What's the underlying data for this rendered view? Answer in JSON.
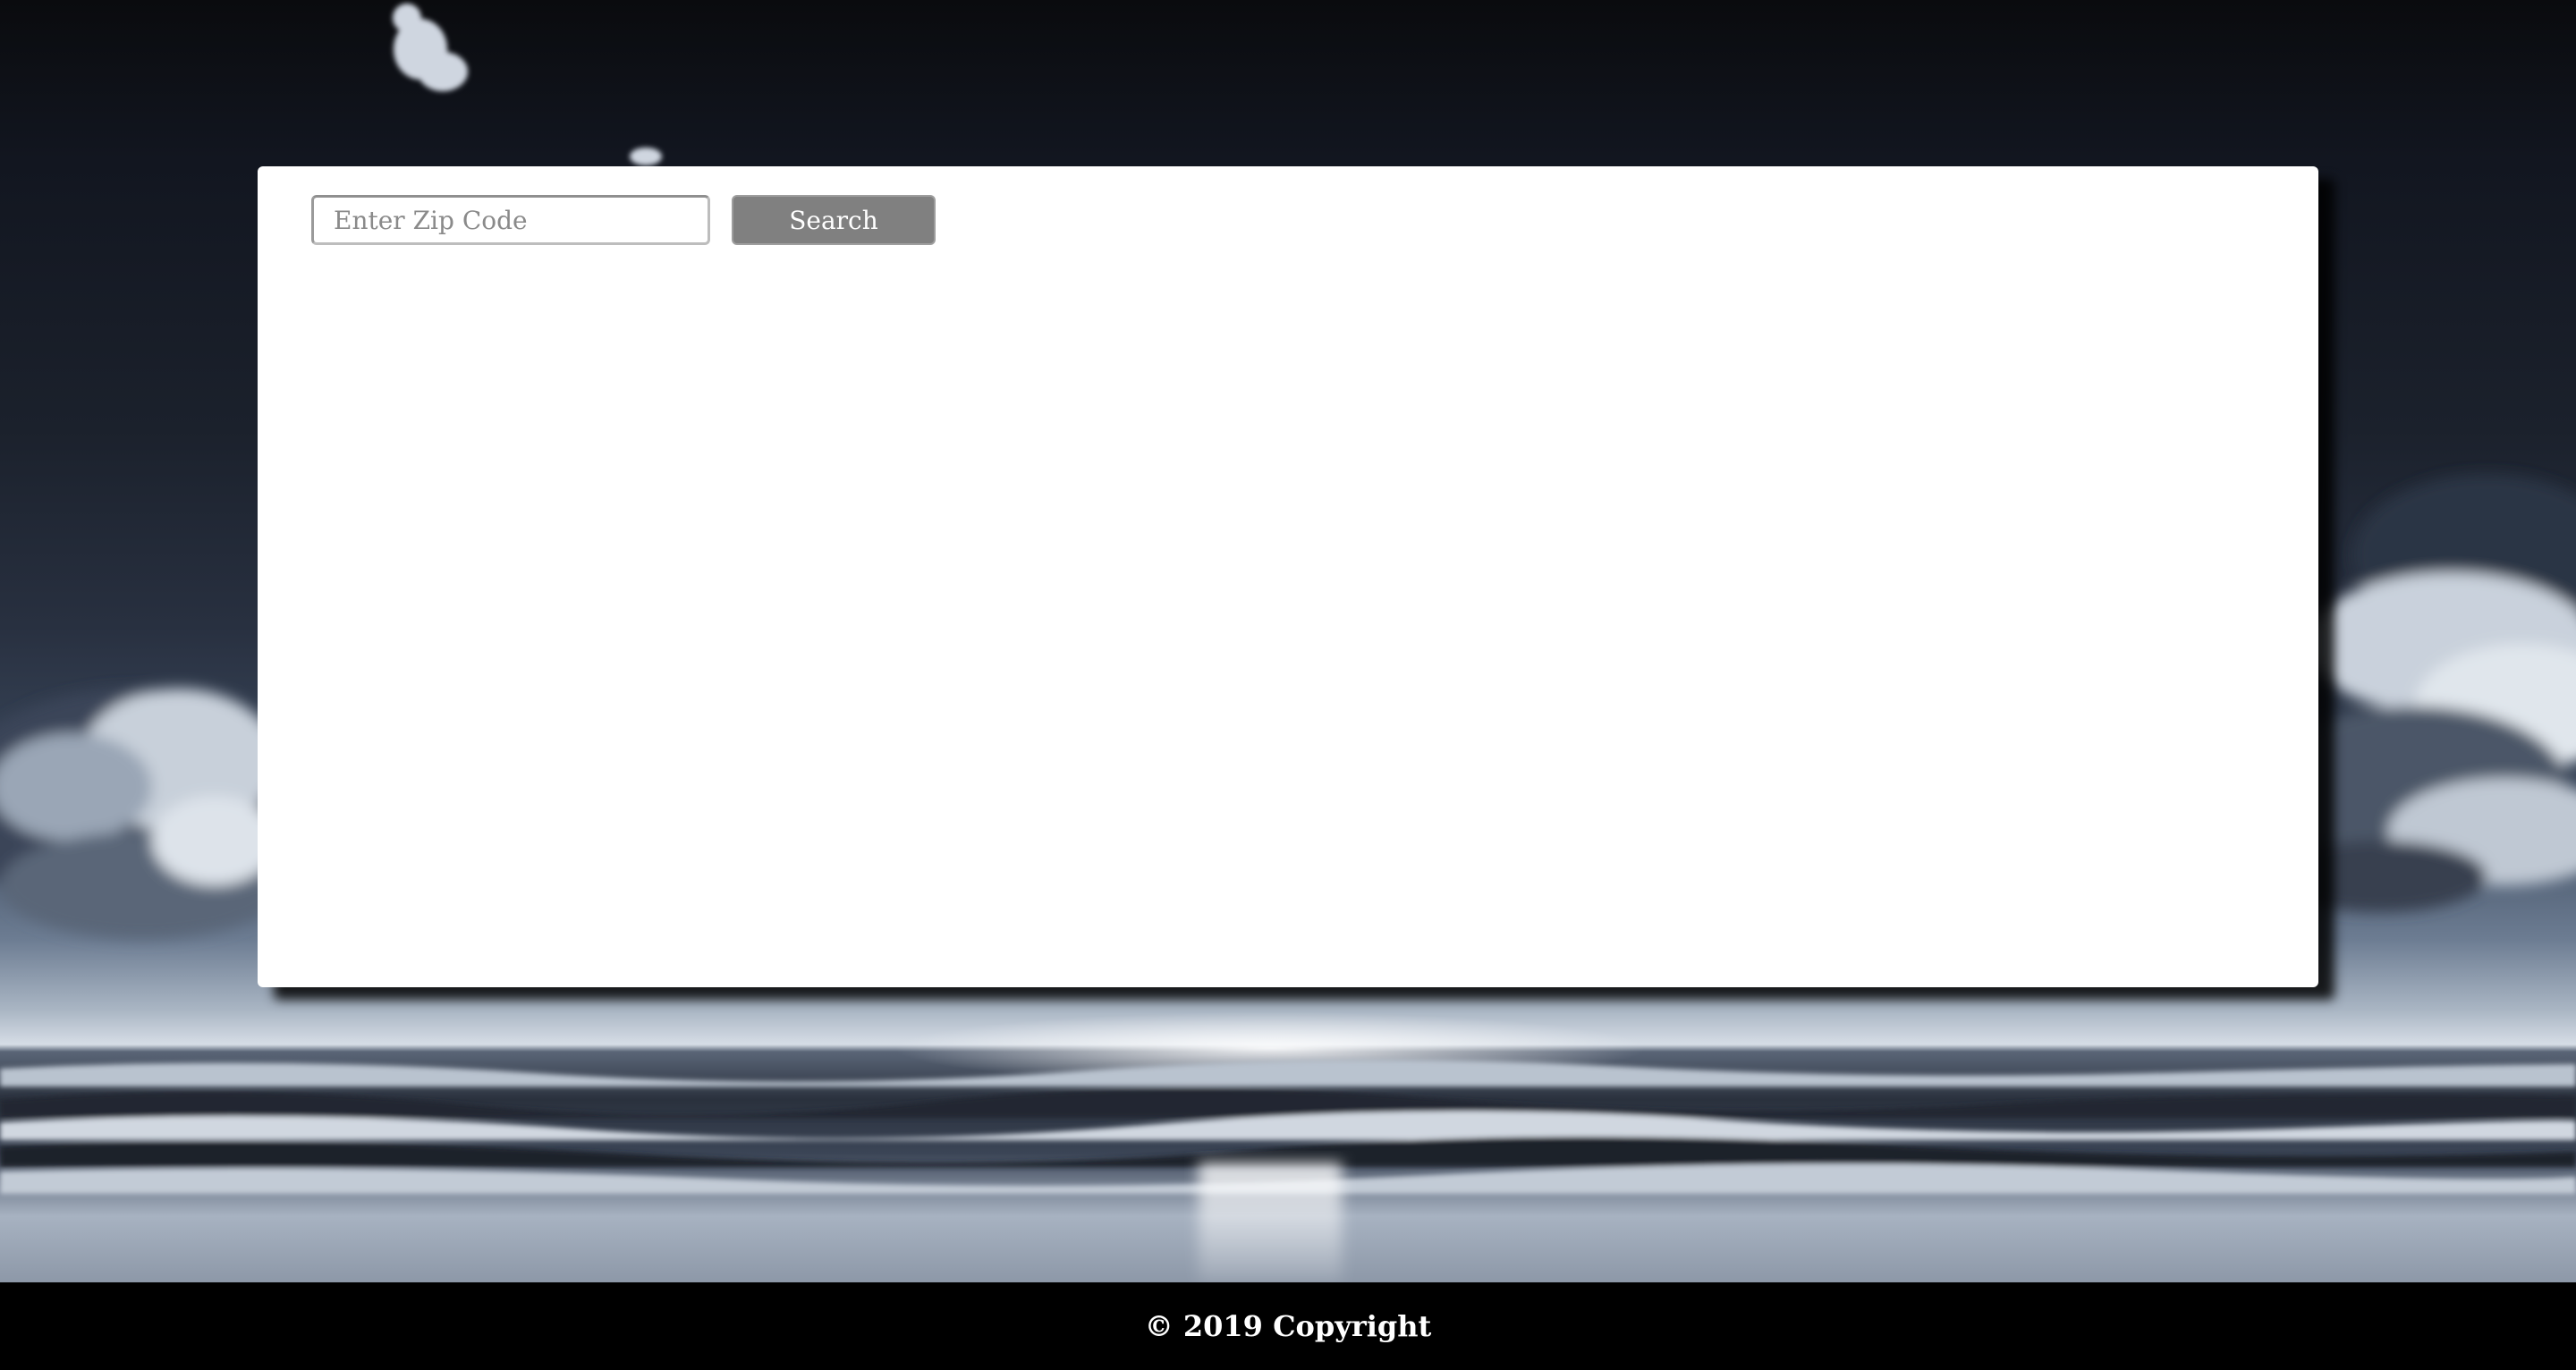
{
  "search": {
    "placeholder": "Enter Zip Code",
    "value": "",
    "button_label": "Search"
  },
  "footer": {
    "copyright": "© 2019 Copyright"
  },
  "background": {
    "theme_colors": [
      "#0a0b0e",
      "#3c4a5e",
      "#d6dde6"
    ]
  },
  "colors": {
    "button_bg": "#808080",
    "card_bg": "#ffffff",
    "footer_bg": "#000000"
  }
}
